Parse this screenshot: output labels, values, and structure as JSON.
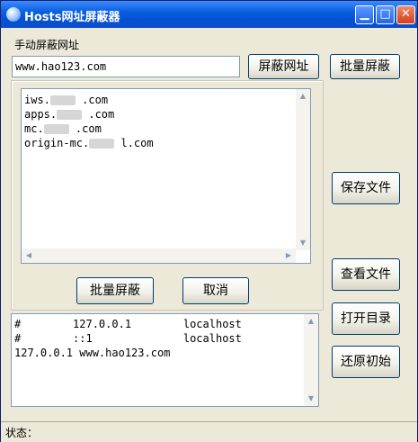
{
  "window": {
    "title": "Hosts网址屏蔽器",
    "minimize_glyph": "▁",
    "maximize_glyph": "□",
    "close_glyph": "✕"
  },
  "block_url": {
    "label": "手动屏蔽网址",
    "value": "www.hao123.com",
    "button": "屏蔽网址"
  },
  "buttons": {
    "batch_block_top": "批量屏蔽",
    "save_file": "保存文件",
    "view_file": "查看文件",
    "open_dir": "打开目录",
    "restore": "还原初始"
  },
  "batch_panel": {
    "lines": [
      {
        "prefix": "iws.",
        "suffix": ".com"
      },
      {
        "prefix": "apps.",
        "suffix": ".com"
      },
      {
        "prefix": "mc.",
        "suffix": ".com"
      },
      {
        "prefix": "origin-mc.",
        "suffix": "l.com"
      }
    ],
    "confirm": "批量屏蔽",
    "cancel": "取消"
  },
  "hosts_content": {
    "lines": [
      "#        127.0.0.1        localhost",
      "#        ::1              localhost",
      "",
      "",
      "127.0.0.1 www.hao123.com"
    ]
  },
  "status": {
    "label": "状态："
  },
  "scroll_glyphs": {
    "up": "▲",
    "down": "▼",
    "left": "◀",
    "right": "▶"
  }
}
